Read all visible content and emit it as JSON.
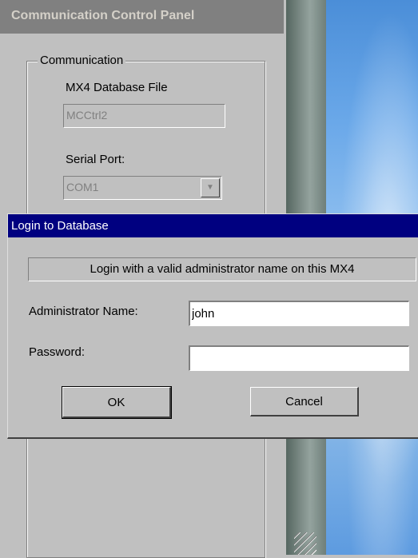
{
  "background_panel": {
    "title": "Communication Control Panel",
    "group_label": "Communication",
    "db_file_label": "MX4 Database File",
    "db_file_value": "MCCtrl2",
    "serial_port_label": "Serial Port:",
    "serial_port_value": "COM1",
    "combo_arrow": "▼"
  },
  "dialog": {
    "title": "Login to Database",
    "info_text": "Login with a valid administrator name on this MX4",
    "admin_name_label": "Administrator Name:",
    "admin_name_value": "john",
    "password_label": "Password:",
    "password_value": "",
    "ok_label": "OK",
    "cancel_label": "Cancel"
  },
  "colors": {
    "title_bar_active": "#000080",
    "title_bar_inactive": "#808080",
    "window_face": "#c0c0c0"
  }
}
